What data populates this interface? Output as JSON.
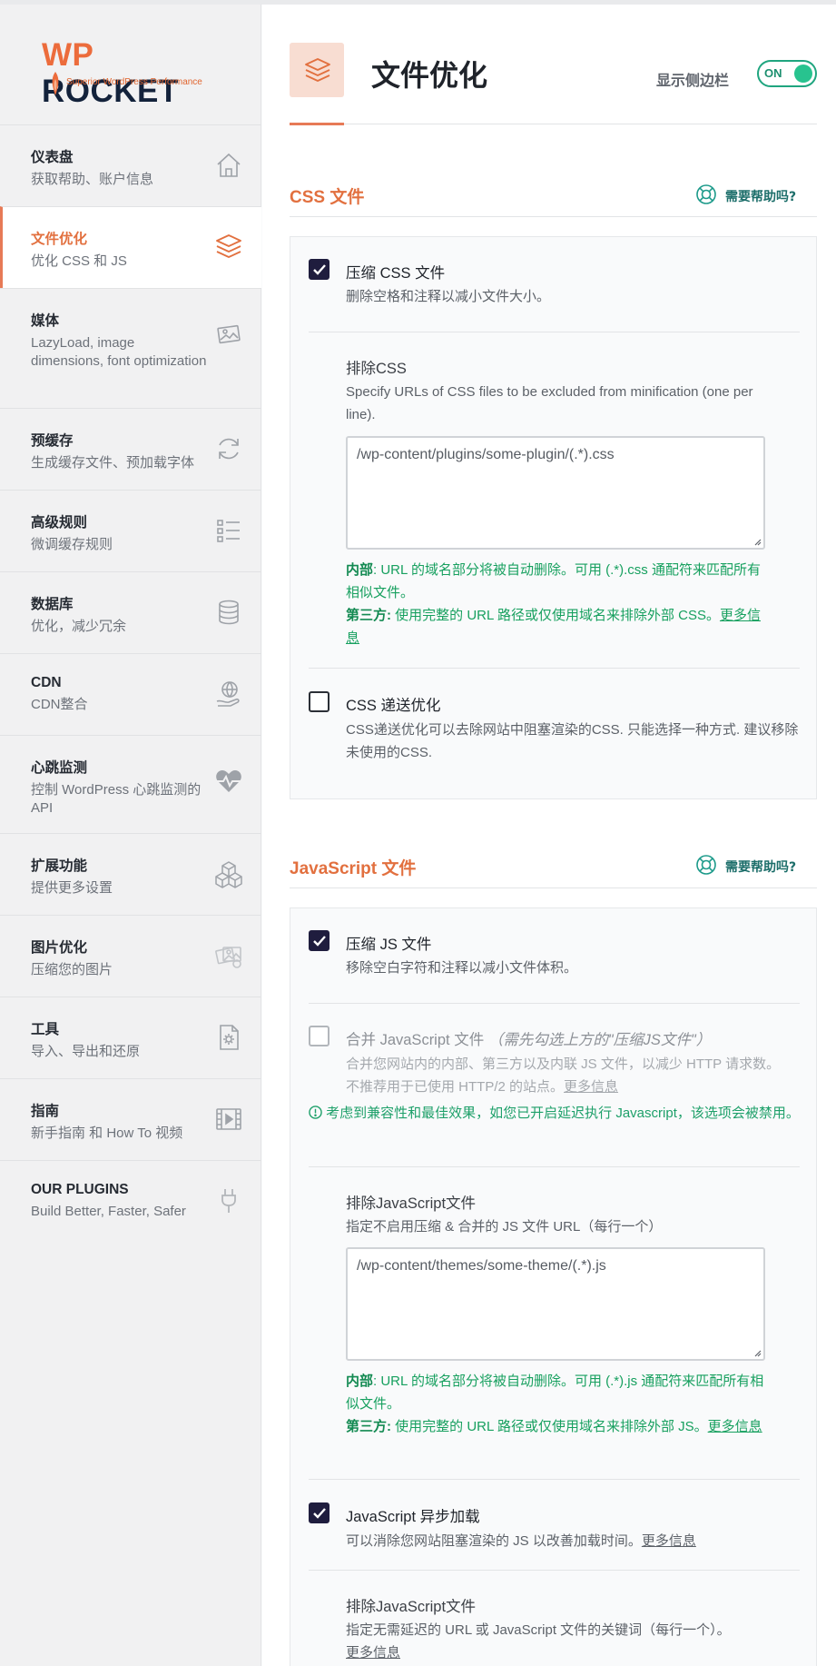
{
  "brand": {
    "wp": "WP",
    "rocket": "ROCKET",
    "tagline": "Superior WordPress Performance"
  },
  "sidebar": {
    "items": [
      {
        "title": "仪表盘",
        "subtitle": "获取帮助、账户信息",
        "icon": "home-icon"
      },
      {
        "title": "文件优化",
        "subtitle": "优化 CSS 和 JS",
        "icon": "layers-icon"
      },
      {
        "title": "媒体",
        "subtitle": "LazyLoad, image dimensions, font optimization",
        "icon": "image-icon"
      },
      {
        "title": "预缓存",
        "subtitle": "生成缓存文件、预加载字体",
        "icon": "refresh-icon"
      },
      {
        "title": "高级规则",
        "subtitle": "微调缓存规则",
        "icon": "checklist-icon"
      },
      {
        "title": "数据库",
        "subtitle": "优化，减少冗余",
        "icon": "database-icon"
      },
      {
        "title": "CDN",
        "subtitle": "CDN整合",
        "icon": "globe-hand-icon"
      },
      {
        "title": "心跳监测",
        "subtitle": "控制 WordPress 心跳监测的 API",
        "icon": "heartbeat-icon"
      },
      {
        "title": "扩展功能",
        "subtitle": "提供更多设置",
        "icon": "cubes-icon"
      },
      {
        "title": "图片优化",
        "subtitle": "压缩您的图片",
        "icon": "images-icon"
      },
      {
        "title": "工具",
        "subtitle": "导入、导出和还原",
        "icon": "file-gear-icon"
      },
      {
        "title": "指南",
        "subtitle": "新手指南 和 How To 视频",
        "icon": "video-icon"
      },
      {
        "title": "OUR PLUGINS",
        "subtitle": "Build Better, Faster, Safer",
        "icon": "plug-icon"
      }
    ]
  },
  "header": {
    "title": "文件优化",
    "sidebar_toggle_label": "显示侧边栏",
    "toggle_state": "ON"
  },
  "css_section": {
    "title": "CSS 文件",
    "help": "需要帮助吗?",
    "minify": {
      "label": "压缩 CSS 文件",
      "desc": "删除空格和注释以减小文件大小。",
      "checked": true
    },
    "exclude": {
      "title": "排除CSS",
      "desc": "Specify URLs of CSS files to be excluded from minification (one per line).",
      "value": "/wp-content/plugins/some-plugin/(.*).css",
      "note_internal_label": "内部",
      "note_internal": ": URL 的域名部分将被自动删除。可用 (.*).css 通配符来匹配所有相似文件。",
      "note_third_label": "第三方:",
      "note_third": " 使用完整的 URL 路径或仅使用域名来排除外部 CSS。",
      "note_more": "更多信息"
    },
    "delivery": {
      "label": "CSS 递送优化",
      "desc": "CSS递送优化可以去除网站中阻塞渲染的CSS. 只能选择一种方式. 建议移除未使用的CSS.",
      "checked": false
    }
  },
  "js_section": {
    "title": "JavaScript 文件",
    "help": "需要帮助吗?",
    "minify": {
      "label": "压缩 JS 文件",
      "desc": "移除空白字符和注释以减小文件体积。",
      "checked": true
    },
    "combine": {
      "label": "合并 JavaScript 文件",
      "hint": "（需先勾选上方的\"压缩JS文件\"）",
      "desc": "合并您网站内的内部、第三方以及内联 JS 文件，以减少 HTTP 请求数。不推荐用于已使用 HTTP/2 的站点。",
      "desc_more": "更多信息",
      "warning": "考虑到兼容性和最佳效果，如您已开启延迟执行 Javascript，该选项会被禁用。",
      "checked": false
    },
    "exclude": {
      "title": "排除JavaScript文件",
      "desc": "指定不启用压缩 & 合并的 JS 文件 URL（每行一个）",
      "value": "/wp-content/themes/some-theme/(.*).js",
      "note_internal_label": "内部",
      "note_internal": ": URL 的域名部分将被自动删除。可用 (.*).js 通配符来匹配所有相似文件。",
      "note_third_label": "第三方:",
      "note_third": " 使用完整的 URL 路径或仅使用域名来排除外部 JS。",
      "note_more": "更多信息"
    },
    "async": {
      "label": "JavaScript 异步加载",
      "desc": "可以消除您网站阻塞渲染的 JS 以改善加载时间。",
      "desc_more": "更多信息",
      "checked": true
    },
    "exclude_defer": {
      "title": "排除JavaScript文件",
      "desc": "指定无需延迟的 URL 或 JavaScript 文件的关键词（每行一个）。",
      "desc_more": "更多信息"
    }
  },
  "colors": {
    "accent": "#e2703f",
    "success": "#17a05f",
    "checkbox": "#1f1d3e"
  }
}
